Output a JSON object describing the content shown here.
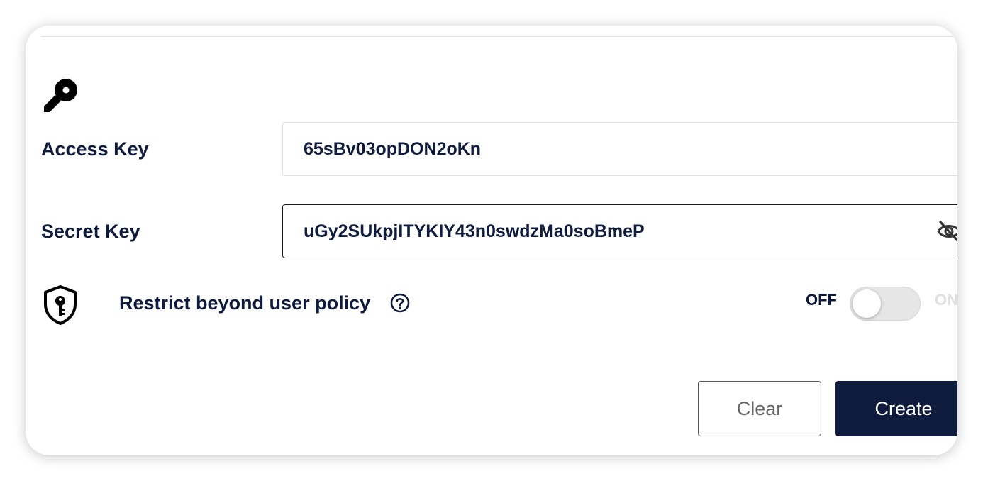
{
  "form": {
    "access_key": {
      "label": "Access Key",
      "value": "65sBv03opDON2oKn"
    },
    "secret_key": {
      "label": "Secret Key",
      "value": "uGy2SUkpjITYKIY43n0swdzMa0soBmeP"
    },
    "restrict_policy": {
      "label": "Restrict beyond user policy",
      "toggle_off_label": "OFF",
      "toggle_on_label": "ON",
      "enabled": false
    },
    "buttons": {
      "clear": "Clear",
      "create": "Create"
    }
  },
  "icons": {
    "header": "key-icon",
    "secret_visibility": "eye-off-icon",
    "policy": "shield-key-icon",
    "help": "help-circle-icon"
  },
  "colors": {
    "primary": "#0f1b3d",
    "toggle_track_off": "#e6e6e6",
    "input_border_active": "#1a1a1a",
    "input_border": "#e0e0e0"
  }
}
